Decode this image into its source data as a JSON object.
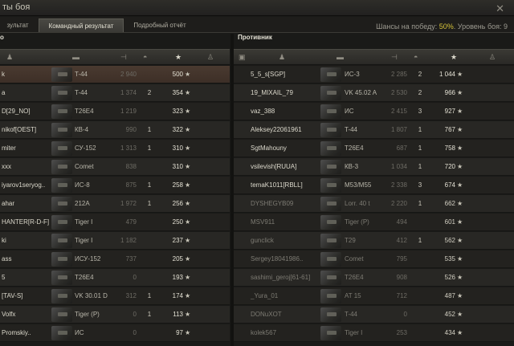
{
  "window": {
    "title": "ты боя",
    "close_icon": "close-icon"
  },
  "tabs": [
    "зультат",
    "Командный результат",
    "Подробный отчёт"
  ],
  "chances": {
    "prefix": "Шансы на победу: ",
    "pct": "50%",
    "suffix": ". Уровень боя: 9"
  },
  "left": {
    "title": "о",
    "rows": [
      {
        "name": "k",
        "tank": "T-44",
        "dmg": "2 940",
        "kills": "",
        "pts": "500",
        "self": true
      },
      {
        "name": "a",
        "tank": "T-44",
        "dmg": "1 374",
        "kills": "2",
        "pts": "354"
      },
      {
        "name": "D[29_NO]",
        "tank": "T26E4",
        "dmg": "1 219",
        "kills": "",
        "pts": "323"
      },
      {
        "name": "nikof[OEST]",
        "tank": "КВ-4",
        "dmg": "990",
        "kills": "1",
        "pts": "322"
      },
      {
        "name": "miter",
        "tank": "СУ-152",
        "dmg": "1 313",
        "kills": "1",
        "pts": "310"
      },
      {
        "name": "xxx",
        "tank": "Comet",
        "dmg": "838",
        "kills": "",
        "pts": "310"
      },
      {
        "name": "iyarov1seryog..",
        "tank": "ИС-8",
        "dmg": "875",
        "kills": "1",
        "pts": "258"
      },
      {
        "name": "ahar",
        "tank": "212А",
        "dmg": "1 972",
        "kills": "1",
        "pts": "256"
      },
      {
        "name": "HANTER[R-D-F]",
        "tank": "Tiger I",
        "dmg": "479",
        "kills": "",
        "pts": "250"
      },
      {
        "name": "ki",
        "tank": "Tiger I",
        "dmg": "1 182",
        "kills": "",
        "pts": "237"
      },
      {
        "name": "ass",
        "tank": "ИСУ-152",
        "dmg": "737",
        "kills": "",
        "pts": "205"
      },
      {
        "name": "5",
        "tank": "T26E4",
        "dmg": "0",
        "kills": "",
        "pts": "193"
      },
      {
        "name": "[TAV-S]",
        "tank": "VK 30.01 D",
        "dmg": "312",
        "kills": "1",
        "pts": "174"
      },
      {
        "name": "Volfx",
        "tank": "Tiger (P)",
        "dmg": "0",
        "kills": "1",
        "pts": "113"
      },
      {
        "name": "Promskiy..",
        "tank": "ИС",
        "dmg": "0",
        "kills": "",
        "pts": "97"
      }
    ]
  },
  "right": {
    "title": "Противник",
    "rows": [
      {
        "name": "5_5_s[SGP]",
        "tank": "ИС-3",
        "dmg": "2 285",
        "kills": "2",
        "pts": "1 044"
      },
      {
        "name": "19_MIXAIL_79",
        "tank": "VK 45.02 A",
        "dmg": "2 530",
        "kills": "2",
        "pts": "966"
      },
      {
        "name": "vaz_388",
        "tank": "ИС",
        "dmg": "2 415",
        "kills": "3",
        "pts": "927"
      },
      {
        "name": "Aleksey22061961",
        "tank": "T-44",
        "dmg": "1 807",
        "kills": "1",
        "pts": "767"
      },
      {
        "name": "SgtMahouny",
        "tank": "T26E4",
        "dmg": "687",
        "kills": "1",
        "pts": "758"
      },
      {
        "name": "vsilevish[RUUA]",
        "tank": "КВ-3",
        "dmg": "1 034",
        "kills": "1",
        "pts": "720"
      },
      {
        "name": "temaK1011[RBLL]",
        "tank": "M53/M55",
        "dmg": "2 338",
        "kills": "3",
        "pts": "674"
      },
      {
        "name": "DYSHEGYB09",
        "tank": "Lorr. 40 t",
        "dmg": "2 220",
        "kills": "1",
        "pts": "662",
        "dead": true
      },
      {
        "name": "MSV911",
        "tank": "Tiger (P)",
        "dmg": "494",
        "kills": "",
        "pts": "601",
        "dead": true
      },
      {
        "name": "gunclick",
        "tank": "T29",
        "dmg": "412",
        "kills": "1",
        "pts": "562",
        "dead": true
      },
      {
        "name": "Sergey18041986..",
        "tank": "Comet",
        "dmg": "795",
        "kills": "",
        "pts": "535",
        "dead": true
      },
      {
        "name": "sashimi_geroj[61-61]",
        "tank": "T26E4",
        "dmg": "908",
        "kills": "",
        "pts": "526",
        "dead": true
      },
      {
        "name": "_Yura_01",
        "tank": "AT 15",
        "dmg": "712",
        "kills": "",
        "pts": "487",
        "dead": true
      },
      {
        "name": "DONuXOT",
        "tank": "T-44",
        "dmg": "0",
        "kills": "",
        "pts": "452",
        "dead": true
      },
      {
        "name": "kolek567",
        "tank": "Tiger I",
        "dmg": "253",
        "kills": "",
        "pts": "434",
        "dead": true
      }
    ]
  }
}
